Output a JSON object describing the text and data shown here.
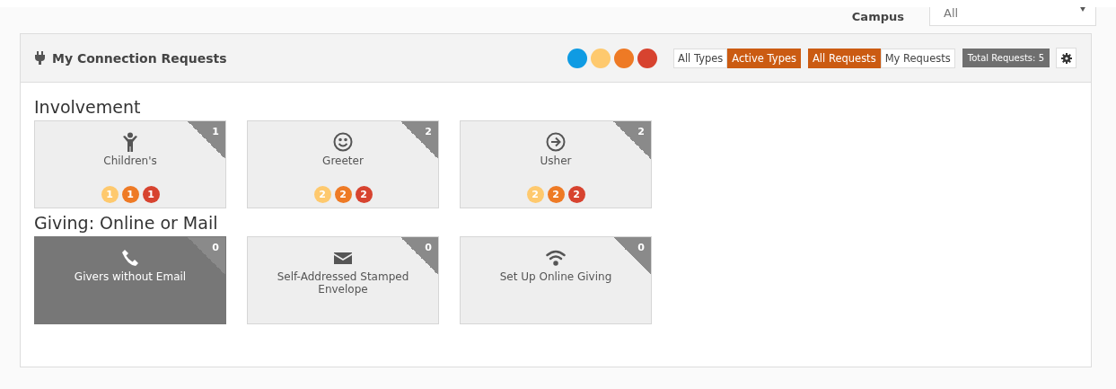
{
  "campus_filter": {
    "label": "Campus",
    "value": "All"
  },
  "panel": {
    "title": "My Connection Requests",
    "legend": [
      {
        "color": "#0f9be3"
      },
      {
        "color": "#fec96e"
      },
      {
        "color": "#ee7a25"
      },
      {
        "color": "#d7432f"
      }
    ],
    "type_toggle": [
      {
        "label": "All Types",
        "selected": false
      },
      {
        "label": "Active Types",
        "selected": true
      }
    ],
    "request_toggle": [
      {
        "label": "All Requests",
        "selected": true
      },
      {
        "label": "My Requests",
        "selected": false
      }
    ],
    "total": "Total Requests: 5"
  },
  "groups": [
    {
      "name": "Involvement",
      "tiles": [
        {
          "kind": "child",
          "name": "Children's",
          "count": "1",
          "selected": false,
          "badges": [
            {
              "text": "1",
              "color": "#fec96e"
            },
            {
              "text": "1",
              "color": "#ee7a25"
            },
            {
              "text": "1",
              "color": "#d7432f"
            }
          ]
        },
        {
          "kind": "smile",
          "name": "Greeter",
          "count": "2",
          "selected": false,
          "badges": [
            {
              "text": "2",
              "color": "#fec96e"
            },
            {
              "text": "2",
              "color": "#ee7a25"
            },
            {
              "text": "2",
              "color": "#d7432f"
            }
          ]
        },
        {
          "kind": "arrow",
          "name": "Usher",
          "count": "2",
          "selected": false,
          "badges": [
            {
              "text": "2",
              "color": "#fec96e"
            },
            {
              "text": "2",
              "color": "#ee7a25"
            },
            {
              "text": "2",
              "color": "#d7432f"
            }
          ]
        }
      ]
    },
    {
      "name": "Giving: Online or Mail",
      "tiles": [
        {
          "kind": "phone",
          "name": "Givers without Email",
          "count": "0",
          "selected": true
        },
        {
          "kind": "envelope",
          "name": "Self-Addressed Stamped Envelope",
          "count": "0",
          "selected": false
        },
        {
          "kind": "wifi",
          "name": "Set Up Online Giving",
          "count": "0",
          "selected": false
        }
      ]
    }
  ]
}
